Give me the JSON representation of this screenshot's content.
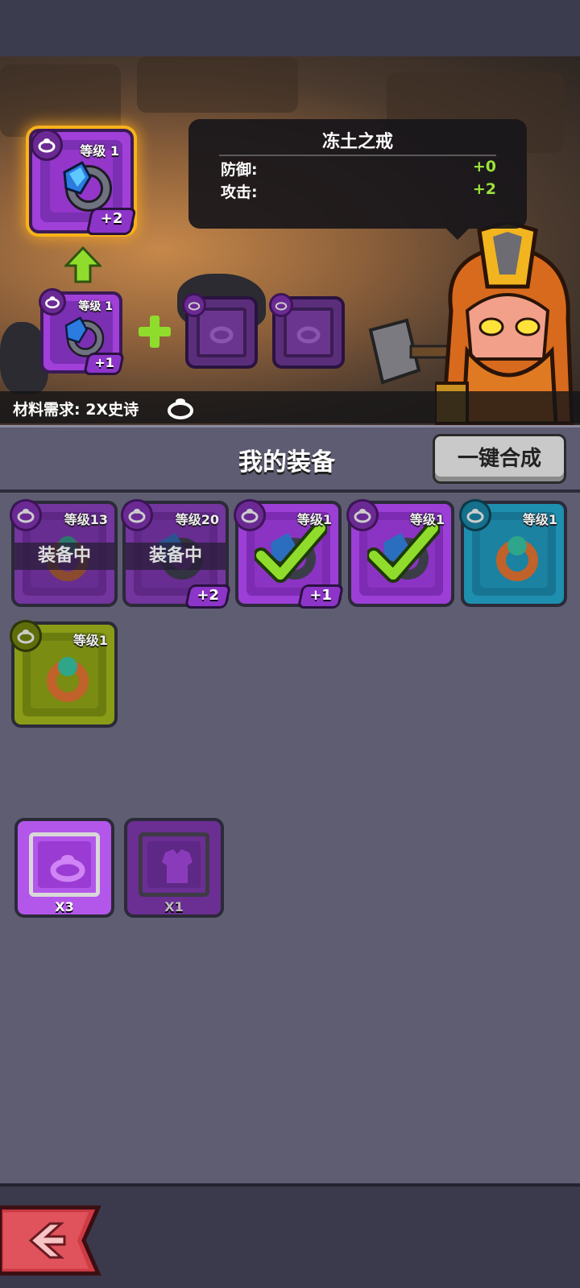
{
  "scene": {
    "target": {
      "level": "等级 1",
      "plus": "+2",
      "icon": "ring-icon"
    },
    "source": {
      "level": "等级 1",
      "plus": "+1",
      "icon": "ring-icon"
    },
    "material_slots": [
      "ring-icon",
      "ring-icon"
    ],
    "tooltip": {
      "title": "冻土之戒",
      "stats": [
        {
          "label": "防御:",
          "value": "+0"
        },
        {
          "label": "攻击:",
          "value": "+2"
        }
      ]
    },
    "material_requirement": "材料需求: 2X史诗"
  },
  "equipment": {
    "title": "我的装备",
    "merge_button": "一键合成",
    "items": [
      {
        "level": "等级13",
        "rarity": "purple",
        "status": "装备中",
        "plus": ""
      },
      {
        "level": "等级20",
        "rarity": "purple",
        "status": "装备中",
        "plus": "+2"
      },
      {
        "level": "等级1",
        "rarity": "purple",
        "status": "",
        "plus": "+1",
        "selected": true
      },
      {
        "level": "等级1",
        "rarity": "purple",
        "status": "",
        "plus": "",
        "selected": true
      },
      {
        "level": "等级1",
        "rarity": "teal",
        "status": "",
        "plus": ""
      },
      {
        "level": "等级1",
        "rarity": "green",
        "status": "",
        "plus": ""
      }
    ],
    "materials": [
      {
        "count": "X3",
        "icon": "ring-icon"
      },
      {
        "count": "X1",
        "icon": "armor-icon"
      }
    ]
  },
  "colors": {
    "epic": "#9c3fd6",
    "rare": "#1f8fb0",
    "uncommon": "#8a9c17",
    "accent_green": "#9be23a"
  }
}
